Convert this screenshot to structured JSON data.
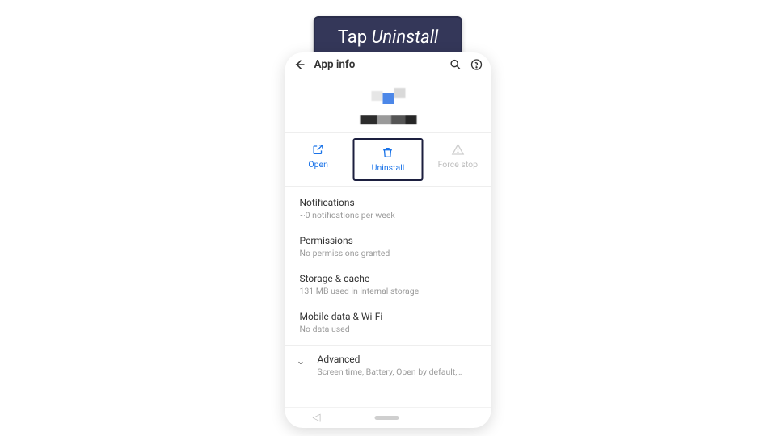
{
  "callout": {
    "prefix": "Tap ",
    "target": "Uninstall"
  },
  "topbar": {
    "title": "App info",
    "back_icon": "back-arrow",
    "search_icon": "search",
    "help_icon": "help"
  },
  "actions": {
    "open": {
      "label": "Open",
      "icon": "open-in-new"
    },
    "uninstall": {
      "label": "Uninstall",
      "icon": "trash"
    },
    "force_stop": {
      "label": "Force stop",
      "icon": "warning"
    }
  },
  "rows": {
    "notifications": {
      "label": "Notifications",
      "sub": "~0 notifications per week"
    },
    "permissions": {
      "label": "Permissions",
      "sub": "No permissions granted"
    },
    "storage": {
      "label": "Storage & cache",
      "sub": "131 MB used in internal storage"
    },
    "mobile": {
      "label": "Mobile data & Wi-Fi",
      "sub": "No data used"
    },
    "advanced": {
      "label": "Advanced",
      "sub": "Screen time, Battery, Open by default, Sto..."
    }
  }
}
